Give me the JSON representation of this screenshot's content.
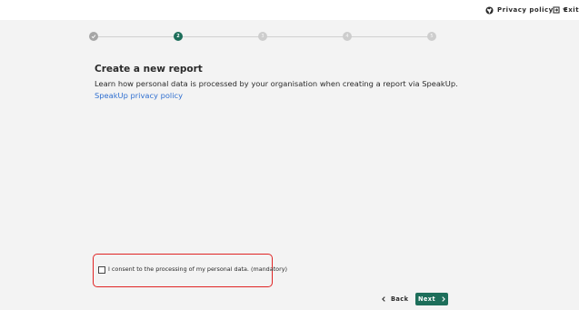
{
  "header": {
    "privacy_label": "Privacy policy",
    "exit_label": "Exit"
  },
  "stepper": {
    "current_step": 2,
    "steps": [
      {
        "status": "done",
        "label": ""
      },
      {
        "status": "active",
        "label": "2"
      },
      {
        "status": "todo",
        "label": "3"
      },
      {
        "status": "todo",
        "label": "4"
      },
      {
        "status": "todo",
        "label": "5"
      }
    ]
  },
  "main": {
    "title": "Create a new report",
    "subtitle": "Learn how personal data is processed by your organisation when creating a report via SpeakUp.",
    "policy_link": "SpeakUp privacy policy"
  },
  "consent": {
    "label": "I consent to the processing of my personal data. (mandatory)",
    "checked": false
  },
  "footer": {
    "back_label": "Back",
    "next_label": "Next"
  },
  "colors": {
    "accent": "#1d6e5a",
    "link": "#2f6fd0",
    "error": "#e02424",
    "background": "#f3f3f3"
  },
  "icons": {
    "privacy": "globe-icon",
    "privacy_menu": "caret-down-icon",
    "exit": "exit-icon",
    "back": "chevron-left-icon",
    "next": "chevron-right-icon",
    "step_done": "check-icon"
  }
}
